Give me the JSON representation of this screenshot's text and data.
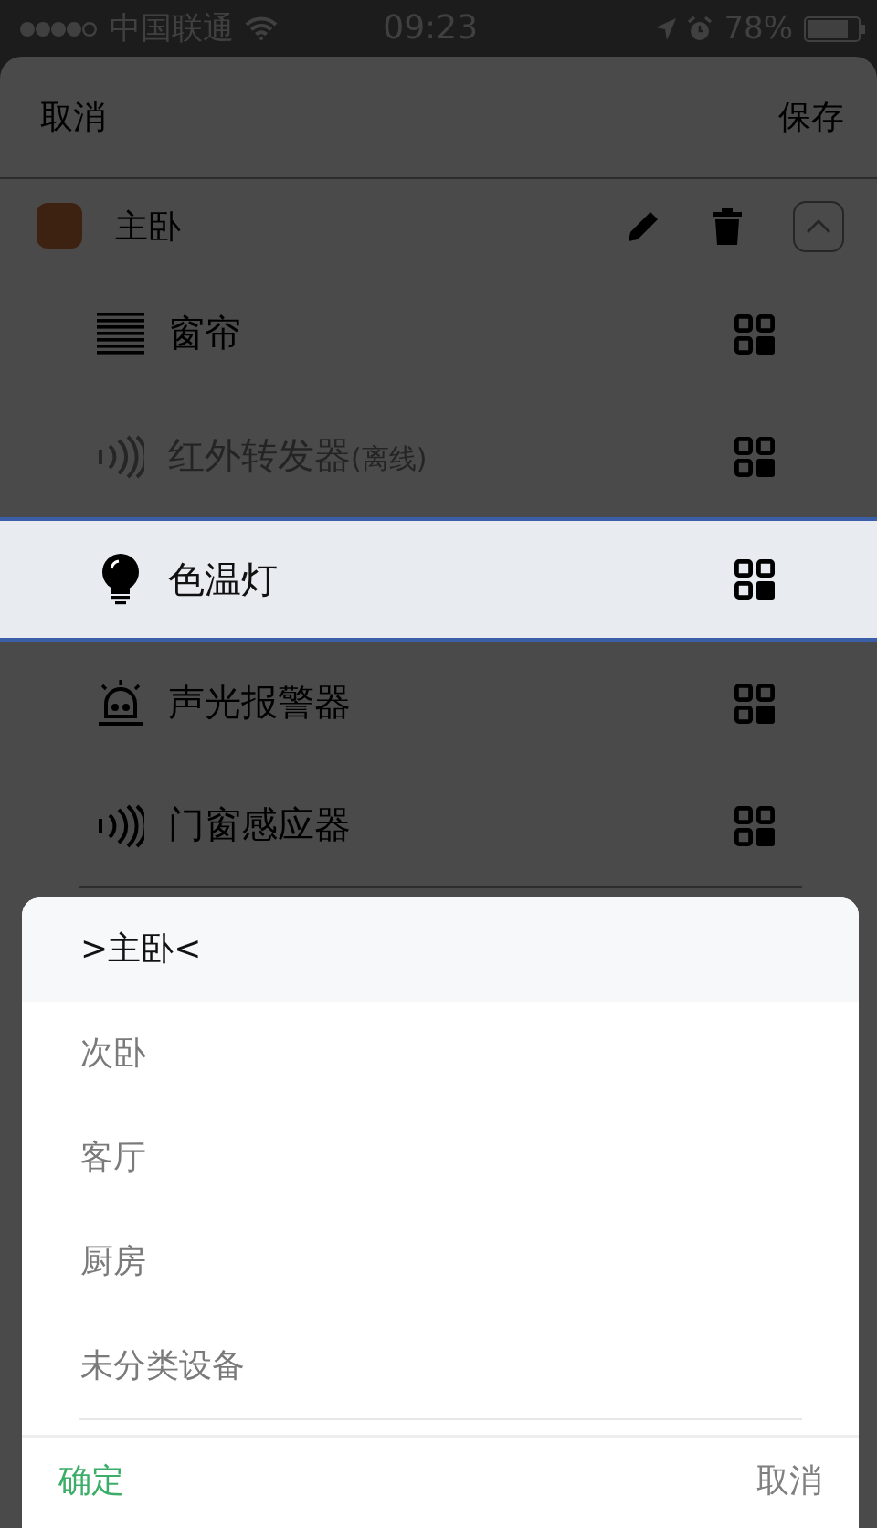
{
  "status_bar": {
    "carrier": "中国联通",
    "time": "09:23",
    "battery": "78%"
  },
  "nav": {
    "left": "取消",
    "right": "保存"
  },
  "room": {
    "name": "主卧",
    "expanded": true
  },
  "devices": [
    {
      "kind": "blinds",
      "name": "窗帘",
      "offline": false,
      "selected": false
    },
    {
      "kind": "ir",
      "name": "红外转发器",
      "note": "(离线)",
      "offline": true,
      "selected": false
    },
    {
      "kind": "bulb",
      "name": "色温灯",
      "offline": false,
      "selected": true
    },
    {
      "kind": "alarm",
      "name": "声光报警器",
      "offline": false,
      "selected": false
    },
    {
      "kind": "sensor",
      "name": "门窗感应器",
      "offline": false,
      "selected": false
    }
  ],
  "picker": {
    "options": [
      {
        "label": ">主卧<",
        "selected": true
      },
      {
        "label": "次卧",
        "selected": false
      },
      {
        "label": "客厅",
        "selected": false
      },
      {
        "label": "厨房",
        "selected": false
      },
      {
        "label": "未分类设备",
        "selected": false
      }
    ],
    "confirm": "确定",
    "cancel": "取消"
  }
}
